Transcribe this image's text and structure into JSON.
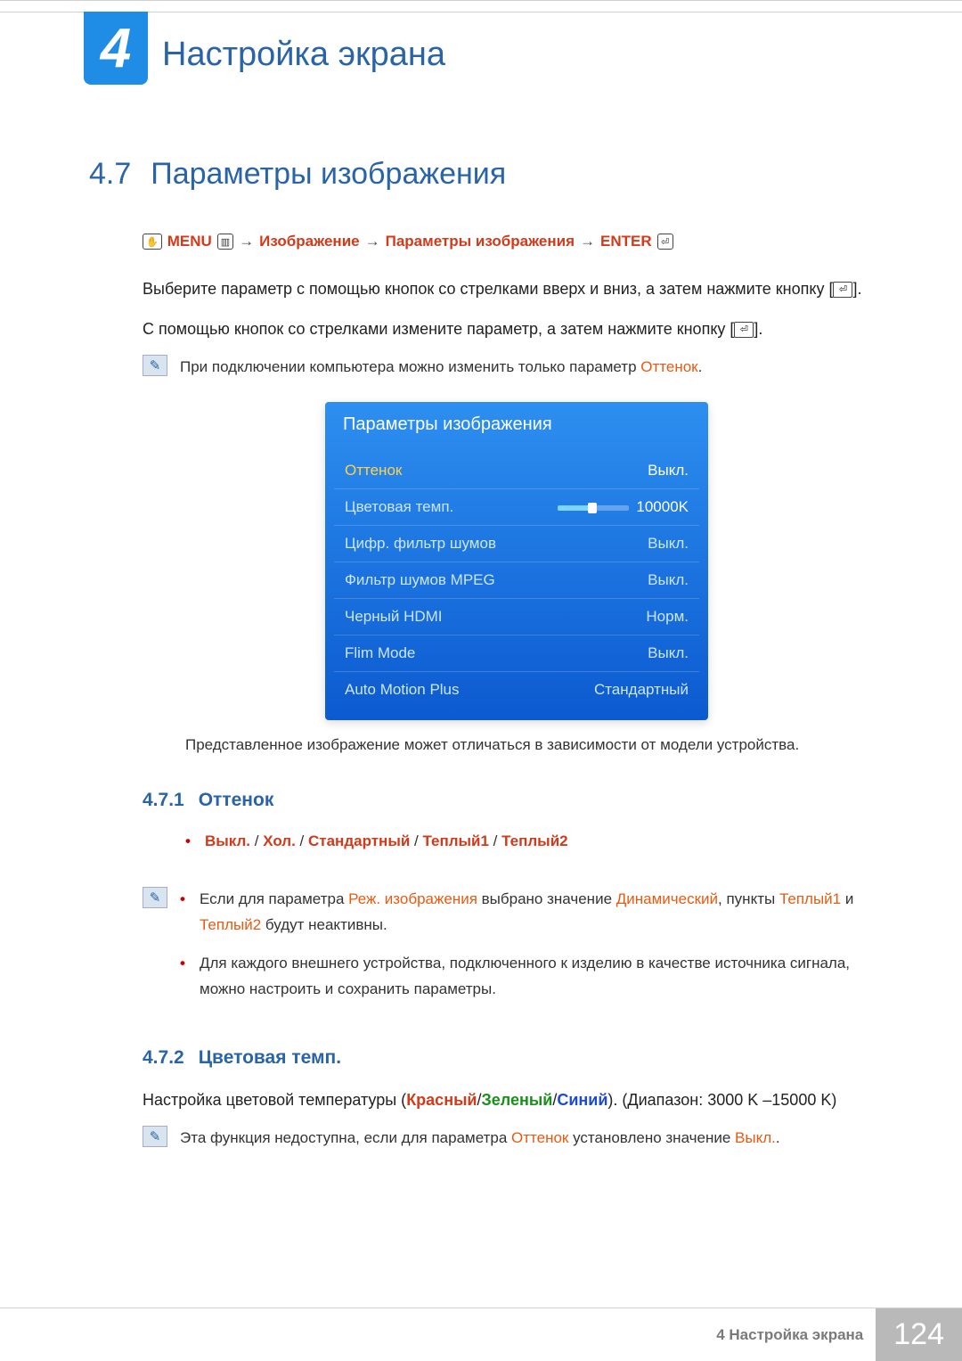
{
  "chapter": {
    "num": "4",
    "title": "Настройка экрана"
  },
  "section": {
    "num": "4.7",
    "title": "Параметры изображения"
  },
  "navpath": {
    "menu": "MENU",
    "p1": "Изображение",
    "p2": "Параметры изображения",
    "enter": "ENTER"
  },
  "body": {
    "p1a": "Выберите параметр с помощью кнопок со стрелками вверх и вниз, а затем нажмите кнопку [",
    "p1b": "].",
    "p2a": "С помощью кнопок со стрелками измените параметр, а затем нажмите кнопку [",
    "p2b": "]."
  },
  "note1": {
    "pre": "При подключении компьютера можно изменить только параметр ",
    "hl": "Оттенок",
    "post": "."
  },
  "osd": {
    "title": "Параметры изображения",
    "rows": [
      {
        "label": "Оттенок",
        "value": "Выкл.",
        "selected": true
      },
      {
        "label": "Цветовая темп.",
        "value": "10000K",
        "slider": true
      },
      {
        "label": "Цифр. фильтр шумов",
        "value": "Выкл."
      },
      {
        "label": "Фильтр шумов MPEG",
        "value": "Выкл."
      },
      {
        "label": "Черный HDMI",
        "value": "Норм."
      },
      {
        "label": "Flim Mode",
        "value": "Выкл."
      },
      {
        "label": "Auto Motion Plus",
        "value": "Стандартный"
      }
    ]
  },
  "caption": "Представленное изображение может отличаться в зависимости от модели устройства.",
  "sub1": {
    "num": "4.7.1",
    "title": "Оттенок",
    "opts": {
      "o1": "Выкл.",
      "s": " / ",
      "o2": "Хол.",
      "o3": "Стандартный",
      "o4": "Теплый1",
      "o5": "Теплый2"
    },
    "n1": {
      "a": "Если для параметра ",
      "b": "Реж. изображения",
      "c": " выбрано значение ",
      "d": "Динамический",
      "e": ", пункты ",
      "f": "Теплый1",
      "g": " и ",
      "h": "Теплый2",
      "i": " будут неактивны."
    },
    "n2": "Для каждого внешнего устройства, подключенного к изделию в качестве источника сигнала, можно настроить и сохранить параметры."
  },
  "sub2": {
    "num": "4.7.2",
    "title": "Цветовая темп.",
    "p": {
      "a": "Настройка цветовой температуры (",
      "r": "Красный",
      "s1": "/",
      "g": "Зеленый",
      "s2": "/",
      "b": "Синий",
      "c": "). (Диапазон: 3000 K –15000 K)"
    },
    "note": {
      "a": "Эта функция недоступна, если для параметра ",
      "b": "Оттенок",
      "c": " установлено значение ",
      "d": "Выкл.",
      "e": "."
    }
  },
  "footer": {
    "label": "4 Настройка экрана",
    "page": "124"
  }
}
